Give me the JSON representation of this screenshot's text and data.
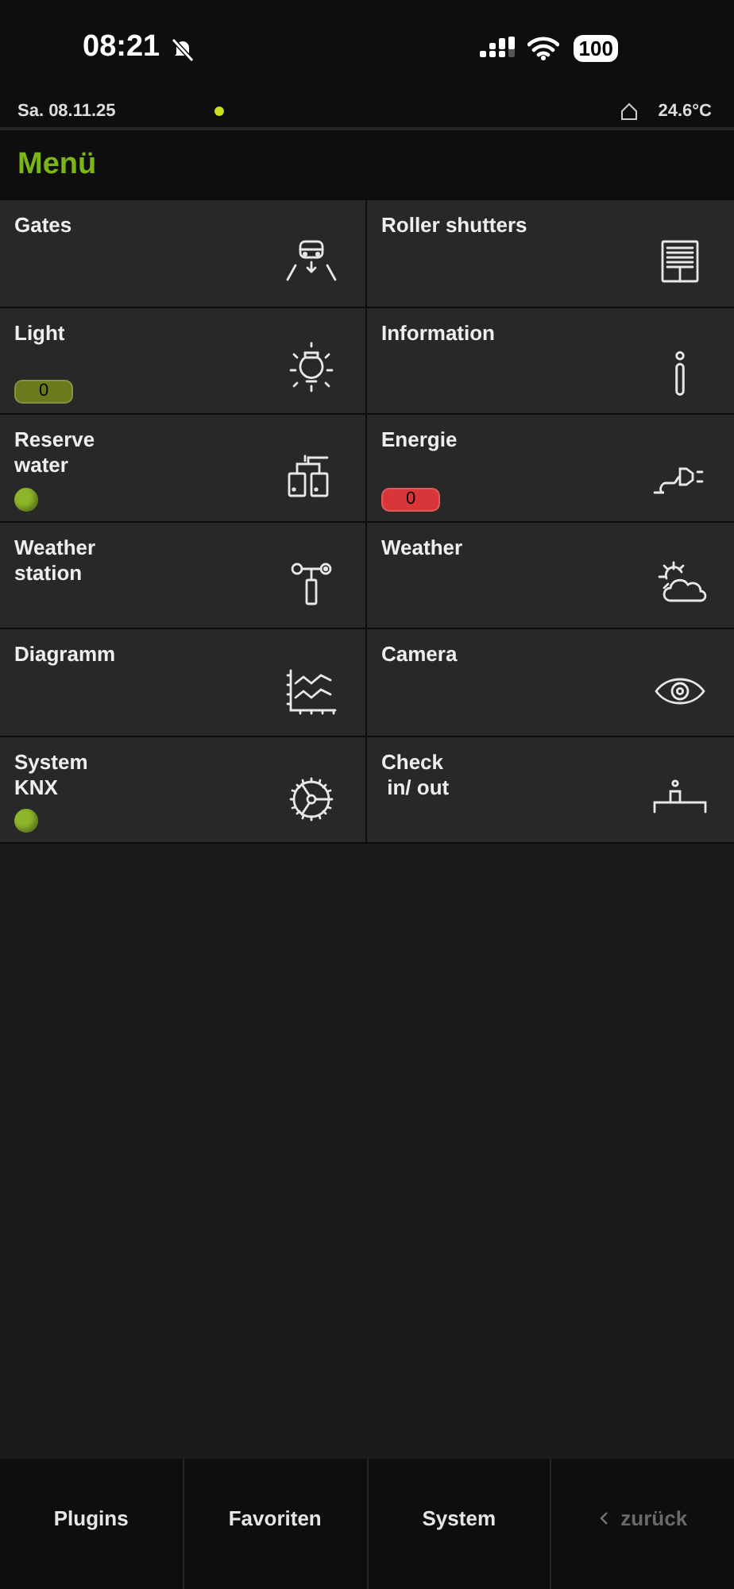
{
  "status_bar": {
    "time": "08:21",
    "battery": "100"
  },
  "info_bar": {
    "date": "Sa. 08.11.25",
    "connection_dot": {
      "color": "#c8e01e"
    },
    "temperature": "24.6°C"
  },
  "header": {
    "title": "Menü"
  },
  "tiles": [
    {
      "title": "Gates"
    },
    {
      "title": "Roller shutters"
    },
    {
      "title": "Light",
      "indicator": {
        "kind": "counter",
        "value": "0",
        "color": "#6b7a1c"
      }
    },
    {
      "title": "Information"
    },
    {
      "title": "Reserve\nwater",
      "indicator": {
        "kind": "led",
        "color": "#8db62a"
      }
    },
    {
      "title": "Energie",
      "indicator": {
        "kind": "counter",
        "value": "0",
        "color": "#d9363a"
      }
    },
    {
      "title": "Weather\nstation"
    },
    {
      "title": "Weather"
    },
    {
      "title": "Diagramm"
    },
    {
      "title": "Camera"
    },
    {
      "title": "System\nKNX",
      "indicator": {
        "kind": "led",
        "color": "#8db62a"
      }
    },
    {
      "title": "Check\n in/ out"
    }
  ],
  "bottom_nav": [
    {
      "label": "Plugins",
      "disabled": false
    },
    {
      "label": "Favoriten",
      "disabled": false
    },
    {
      "label": "System",
      "disabled": false
    },
    {
      "label": "zurück",
      "disabled": true,
      "kind": "back"
    }
  ]
}
